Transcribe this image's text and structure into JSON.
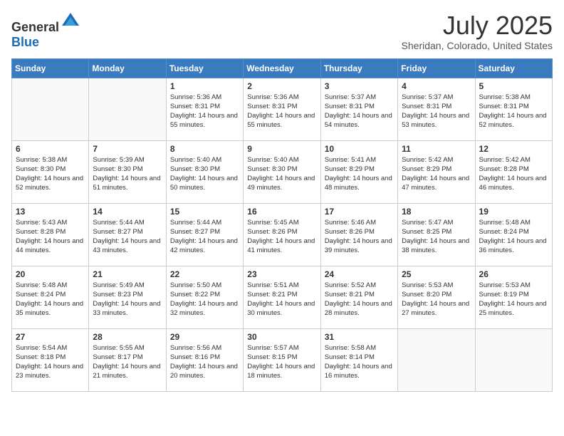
{
  "header": {
    "logo": {
      "general": "General",
      "blue": "Blue"
    },
    "title": "July 2025",
    "location": "Sheridan, Colorado, United States"
  },
  "calendar": {
    "days_of_week": [
      "Sunday",
      "Monday",
      "Tuesday",
      "Wednesday",
      "Thursday",
      "Friday",
      "Saturday"
    ],
    "weeks": [
      [
        {
          "day": "",
          "info": ""
        },
        {
          "day": "",
          "info": ""
        },
        {
          "day": "1",
          "info": "Sunrise: 5:36 AM\nSunset: 8:31 PM\nDaylight: 14 hours and 55 minutes."
        },
        {
          "day": "2",
          "info": "Sunrise: 5:36 AM\nSunset: 8:31 PM\nDaylight: 14 hours and 55 minutes."
        },
        {
          "day": "3",
          "info": "Sunrise: 5:37 AM\nSunset: 8:31 PM\nDaylight: 14 hours and 54 minutes."
        },
        {
          "day": "4",
          "info": "Sunrise: 5:37 AM\nSunset: 8:31 PM\nDaylight: 14 hours and 53 minutes."
        },
        {
          "day": "5",
          "info": "Sunrise: 5:38 AM\nSunset: 8:31 PM\nDaylight: 14 hours and 52 minutes."
        }
      ],
      [
        {
          "day": "6",
          "info": "Sunrise: 5:38 AM\nSunset: 8:30 PM\nDaylight: 14 hours and 52 minutes."
        },
        {
          "day": "7",
          "info": "Sunrise: 5:39 AM\nSunset: 8:30 PM\nDaylight: 14 hours and 51 minutes."
        },
        {
          "day": "8",
          "info": "Sunrise: 5:40 AM\nSunset: 8:30 PM\nDaylight: 14 hours and 50 minutes."
        },
        {
          "day": "9",
          "info": "Sunrise: 5:40 AM\nSunset: 8:30 PM\nDaylight: 14 hours and 49 minutes."
        },
        {
          "day": "10",
          "info": "Sunrise: 5:41 AM\nSunset: 8:29 PM\nDaylight: 14 hours and 48 minutes."
        },
        {
          "day": "11",
          "info": "Sunrise: 5:42 AM\nSunset: 8:29 PM\nDaylight: 14 hours and 47 minutes."
        },
        {
          "day": "12",
          "info": "Sunrise: 5:42 AM\nSunset: 8:28 PM\nDaylight: 14 hours and 46 minutes."
        }
      ],
      [
        {
          "day": "13",
          "info": "Sunrise: 5:43 AM\nSunset: 8:28 PM\nDaylight: 14 hours and 44 minutes."
        },
        {
          "day": "14",
          "info": "Sunrise: 5:44 AM\nSunset: 8:27 PM\nDaylight: 14 hours and 43 minutes."
        },
        {
          "day": "15",
          "info": "Sunrise: 5:44 AM\nSunset: 8:27 PM\nDaylight: 14 hours and 42 minutes."
        },
        {
          "day": "16",
          "info": "Sunrise: 5:45 AM\nSunset: 8:26 PM\nDaylight: 14 hours and 41 minutes."
        },
        {
          "day": "17",
          "info": "Sunrise: 5:46 AM\nSunset: 8:26 PM\nDaylight: 14 hours and 39 minutes."
        },
        {
          "day": "18",
          "info": "Sunrise: 5:47 AM\nSunset: 8:25 PM\nDaylight: 14 hours and 38 minutes."
        },
        {
          "day": "19",
          "info": "Sunrise: 5:48 AM\nSunset: 8:24 PM\nDaylight: 14 hours and 36 minutes."
        }
      ],
      [
        {
          "day": "20",
          "info": "Sunrise: 5:48 AM\nSunset: 8:24 PM\nDaylight: 14 hours and 35 minutes."
        },
        {
          "day": "21",
          "info": "Sunrise: 5:49 AM\nSunset: 8:23 PM\nDaylight: 14 hours and 33 minutes."
        },
        {
          "day": "22",
          "info": "Sunrise: 5:50 AM\nSunset: 8:22 PM\nDaylight: 14 hours and 32 minutes."
        },
        {
          "day": "23",
          "info": "Sunrise: 5:51 AM\nSunset: 8:21 PM\nDaylight: 14 hours and 30 minutes."
        },
        {
          "day": "24",
          "info": "Sunrise: 5:52 AM\nSunset: 8:21 PM\nDaylight: 14 hours and 28 minutes."
        },
        {
          "day": "25",
          "info": "Sunrise: 5:53 AM\nSunset: 8:20 PM\nDaylight: 14 hours and 27 minutes."
        },
        {
          "day": "26",
          "info": "Sunrise: 5:53 AM\nSunset: 8:19 PM\nDaylight: 14 hours and 25 minutes."
        }
      ],
      [
        {
          "day": "27",
          "info": "Sunrise: 5:54 AM\nSunset: 8:18 PM\nDaylight: 14 hours and 23 minutes."
        },
        {
          "day": "28",
          "info": "Sunrise: 5:55 AM\nSunset: 8:17 PM\nDaylight: 14 hours and 21 minutes."
        },
        {
          "day": "29",
          "info": "Sunrise: 5:56 AM\nSunset: 8:16 PM\nDaylight: 14 hours and 20 minutes."
        },
        {
          "day": "30",
          "info": "Sunrise: 5:57 AM\nSunset: 8:15 PM\nDaylight: 14 hours and 18 minutes."
        },
        {
          "day": "31",
          "info": "Sunrise: 5:58 AM\nSunset: 8:14 PM\nDaylight: 14 hours and 16 minutes."
        },
        {
          "day": "",
          "info": ""
        },
        {
          "day": "",
          "info": ""
        }
      ]
    ]
  }
}
